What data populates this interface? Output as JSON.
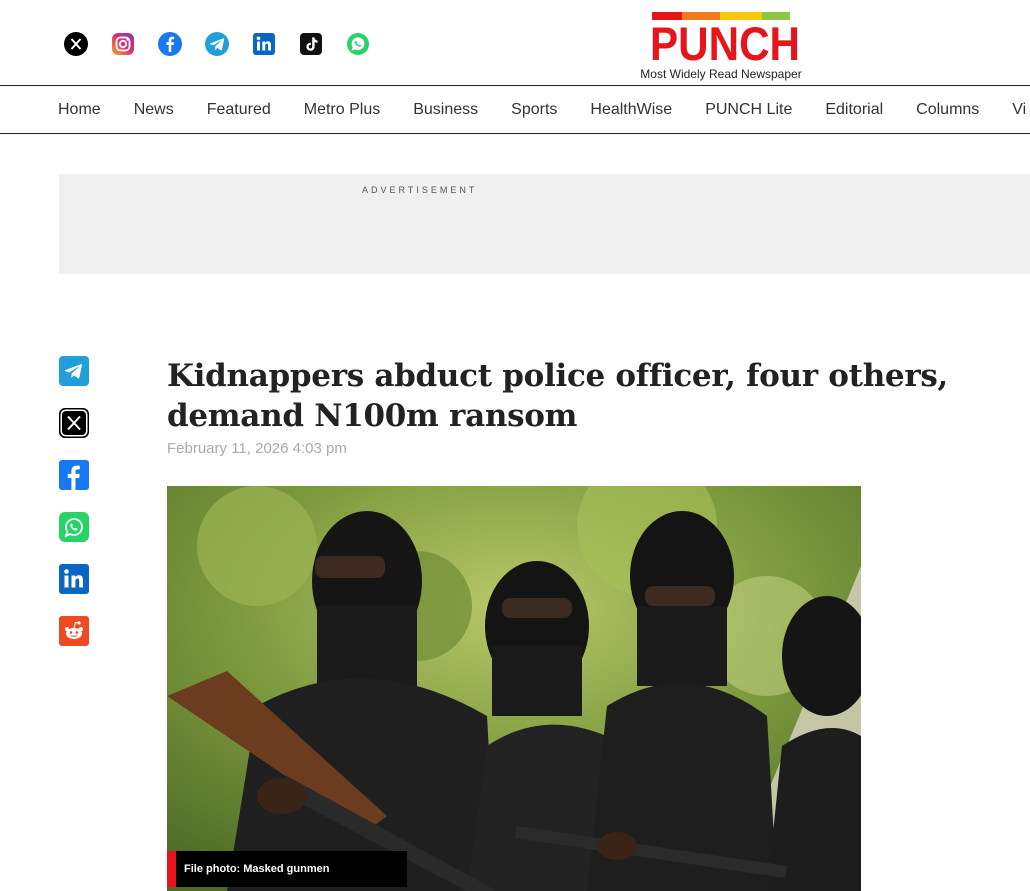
{
  "header": {
    "social_icons": [
      "x-icon",
      "instagram-icon",
      "facebook-icon",
      "telegram-icon",
      "linkedin-icon",
      "tiktok-icon",
      "whatsapp-icon"
    ],
    "brand": {
      "name": "PUNCH",
      "tagline": "Most Widely Read Newspaper",
      "brand_color": "#e8141b"
    }
  },
  "nav": {
    "items": [
      "Home",
      "News",
      "Featured",
      "Metro Plus",
      "Business",
      "Sports",
      "HealthWise",
      "PUNCH Lite",
      "Editorial",
      "Columns",
      "Vi"
    ]
  },
  "ad": {
    "label": "ADVERTISEMENT"
  },
  "share": {
    "icons": [
      "telegram-icon",
      "x-icon",
      "facebook-icon",
      "whatsapp-icon",
      "linkedin-icon",
      "reddit-icon"
    ]
  },
  "article": {
    "headline": "Kidnappers abduct police officer, four others, demand N100m ransom",
    "date": "February 11, 2026 4:03 pm",
    "image_caption": "File photo: Masked gunmen"
  }
}
